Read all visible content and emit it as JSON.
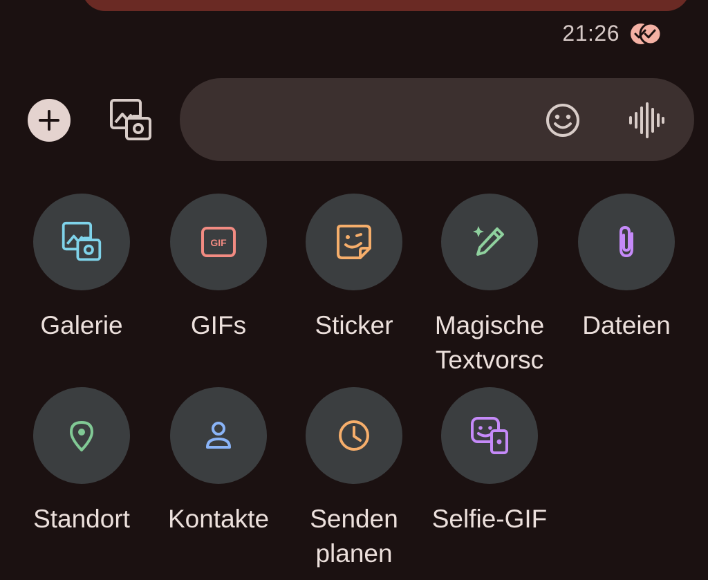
{
  "message": {
    "time": "21:26",
    "status_icon": "read-receipt-icon"
  },
  "compose": {
    "add_icon": "plus-icon",
    "gallery_icon": "gallery-camera-icon",
    "input_value": "",
    "emoji_icon": "emoji-icon",
    "voice_icon": "voice-waveform-icon"
  },
  "attachments": [
    {
      "label": "Galerie",
      "icon": "gallery-camera-icon",
      "color": "#7fd3ea"
    },
    {
      "label": "GIFs",
      "icon": "gif-icon",
      "color": "#f28b82"
    },
    {
      "label": "Sticker",
      "icon": "sticker-icon",
      "color": "#f6ae6b"
    },
    {
      "label": "Magische\nTextvorsc",
      "icon": "magic-pen-icon",
      "color": "#8fd19e"
    },
    {
      "label": "Dateien",
      "icon": "paperclip-icon",
      "color": "#c58af9"
    },
    {
      "label": "Standort",
      "icon": "location-pin-icon",
      "color": "#81c995"
    },
    {
      "label": "Kontakte",
      "icon": "contact-person-icon",
      "color": "#8ab4f8"
    },
    {
      "label": "Senden\nplanen",
      "icon": "clock-icon",
      "color": "#f6ae6b"
    },
    {
      "label": "Selfie-GIF",
      "icon": "selfie-gif-icon",
      "color": "#c58af9"
    }
  ],
  "colors": {
    "background": "#1b1111",
    "bubble": "#6a2a24",
    "input_pill": "#3c302f",
    "tile_circle": "#3b3e40",
    "plus_button": "#e4d3cf"
  }
}
